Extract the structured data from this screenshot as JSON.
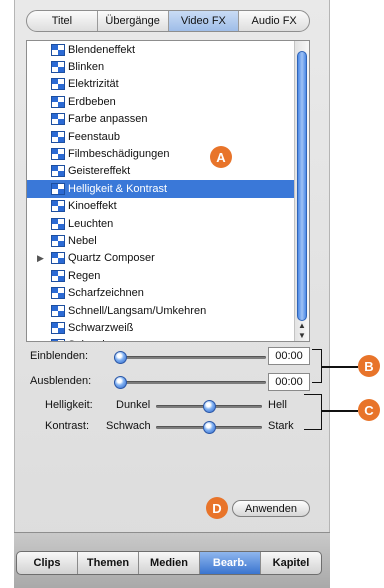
{
  "tabs_top": [
    {
      "label": "Titel",
      "active": false
    },
    {
      "label": "Übergänge",
      "active": false
    },
    {
      "label": "Video FX",
      "active": true
    },
    {
      "label": "Audio FX",
      "active": false
    }
  ],
  "effects": [
    {
      "label": "Blendeneffekt",
      "selected": false,
      "expandable": false
    },
    {
      "label": "Blinken",
      "selected": false,
      "expandable": false
    },
    {
      "label": "Elektrizität",
      "selected": false,
      "expandable": false
    },
    {
      "label": "Erdbeben",
      "selected": false,
      "expandable": false
    },
    {
      "label": "Farbe anpassen",
      "selected": false,
      "expandable": false
    },
    {
      "label": "Feenstaub",
      "selected": false,
      "expandable": false
    },
    {
      "label": "Filmbeschädigungen",
      "selected": false,
      "expandable": false
    },
    {
      "label": "Geistereffekt",
      "selected": false,
      "expandable": false
    },
    {
      "label": "Helligkeit & Kontrast",
      "selected": true,
      "expandable": false
    },
    {
      "label": "Kinoeffekt",
      "selected": false,
      "expandable": false
    },
    {
      "label": "Leuchten",
      "selected": false,
      "expandable": false
    },
    {
      "label": "Nebel",
      "selected": false,
      "expandable": false
    },
    {
      "label": "Quartz Composer",
      "selected": false,
      "expandable": true
    },
    {
      "label": "Regen",
      "selected": false,
      "expandable": false
    },
    {
      "label": "Scharfzeichnen",
      "selected": false,
      "expandable": false
    },
    {
      "label": "Schnell/Langsam/Umkehren",
      "selected": false,
      "expandable": false
    },
    {
      "label": "Schwarzweiß",
      "selected": false,
      "expandable": false
    },
    {
      "label": "Spiegeln",
      "selected": false,
      "expandable": false
    }
  ],
  "controls": {
    "fade_in": {
      "label": "Einblenden:",
      "value": "00:00",
      "level": 0.0
    },
    "fade_out": {
      "label": "Ausblenden:",
      "value": "00:00",
      "level": 0.0
    },
    "brightness": {
      "label": "Helligkeit:",
      "min_label": "Dunkel",
      "max_label": "Hell",
      "level": 0.5
    },
    "contrast": {
      "label": "Kontrast:",
      "min_label": "Schwach",
      "max_label": "Stark",
      "level": 0.5
    }
  },
  "apply_button": "Anwenden",
  "tabs_bottom": [
    {
      "label": "Clips",
      "active": false
    },
    {
      "label": "Themen",
      "active": false
    },
    {
      "label": "Medien",
      "active": false
    },
    {
      "label": "Bearb.",
      "active": true
    },
    {
      "label": "Kapitel",
      "active": false
    }
  ],
  "callouts": {
    "a": "A",
    "b": "B",
    "c": "C",
    "d": "D"
  },
  "colors": {
    "accent": "#3a78d8",
    "callout": "#e8742a"
  }
}
